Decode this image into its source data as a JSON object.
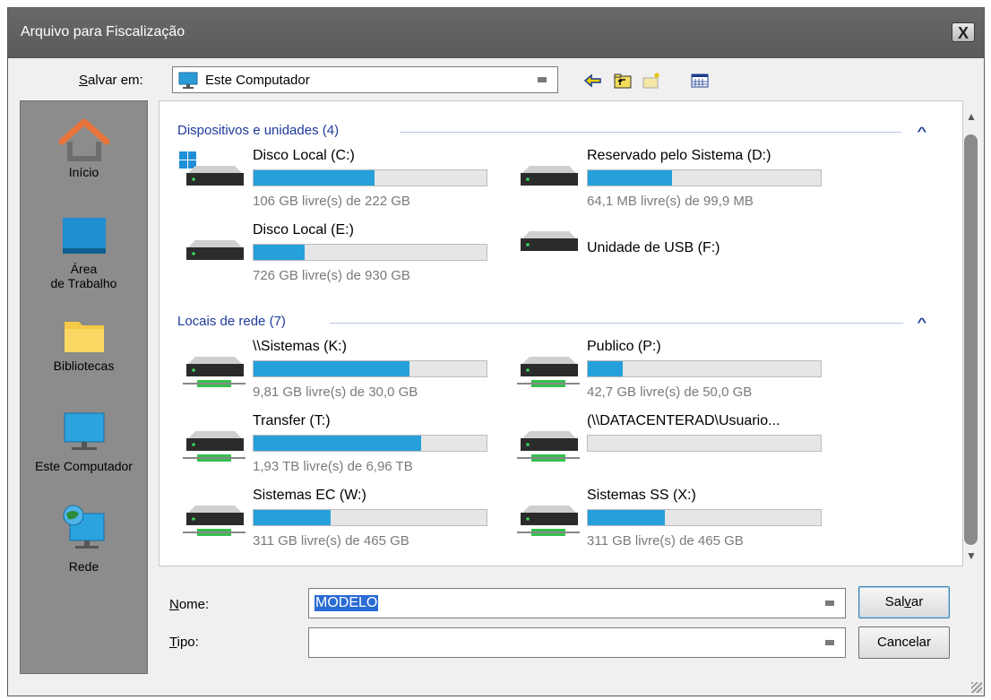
{
  "window": {
    "title": "Arquivo para Fiscalização",
    "close_label": "X"
  },
  "save_in": {
    "label": "Salvar em:",
    "value": "Este Computador"
  },
  "places": [
    {
      "label": "Início",
      "icon": "home-icon"
    },
    {
      "label": "Área\nde Trabalho",
      "icon": "desktop-icon"
    },
    {
      "label": "Bibliotecas",
      "icon": "libraries-icon"
    },
    {
      "label": "Este Computador",
      "icon": "computer-icon"
    },
    {
      "label": "Rede",
      "icon": "network-icon"
    }
  ],
  "groups": {
    "devices": {
      "title": "Dispositivos e unidades (4)"
    },
    "network": {
      "title": "Locais de rede (7)"
    }
  },
  "drives": [
    {
      "name": "Disco Local (C:)",
      "info": "106 GB livre(s) de 222 GB",
      "used": 0.52,
      "type": "local-windows"
    },
    {
      "name": "Reservado pelo Sistema (D:)",
      "info": "64,1 MB livre(s) de 99,9 MB",
      "used": 0.36,
      "type": "local"
    },
    {
      "name": "Disco Local (E:)",
      "info": "726 GB livre(s) de 930 GB",
      "used": 0.22,
      "type": "local"
    },
    {
      "name": "Unidade de USB (F:)",
      "info": "",
      "used": null,
      "type": "local"
    },
    {
      "name": "\\\\Sistemas (K:)",
      "info": "9,81 GB livre(s) de 30,0 GB",
      "used": 0.67,
      "type": "network"
    },
    {
      "name": "Publico (P:)",
      "info": "42,7 GB livre(s) de 50,0 GB",
      "used": 0.15,
      "type": "network"
    },
    {
      "name": "Transfer (T:)",
      "info": "1,93 TB livre(s) de 6,96 TB",
      "used": 0.72,
      "type": "network"
    },
    {
      "name": "(\\\\DATACENTERAD\\Usuario...",
      "info": "",
      "used": 0.0,
      "type": "network"
    },
    {
      "name": "Sistemas EC (W:)",
      "info": "311 GB livre(s) de 465 GB",
      "used": 0.33,
      "type": "network"
    },
    {
      "name": "Sistemas SS (X:)",
      "info": "311 GB livre(s) de 465 GB",
      "used": 0.33,
      "type": "network"
    }
  ],
  "form": {
    "name_label": "Nome:",
    "name_value": "MODELO",
    "type_label": "Tipo:",
    "type_value": ""
  },
  "buttons": {
    "save": "Salvar",
    "cancel": "Cancelar"
  },
  "colors": {
    "bar_fill": "#26a0da",
    "group_header": "#1e3a9a",
    "selection": "#2a6bd4"
  }
}
